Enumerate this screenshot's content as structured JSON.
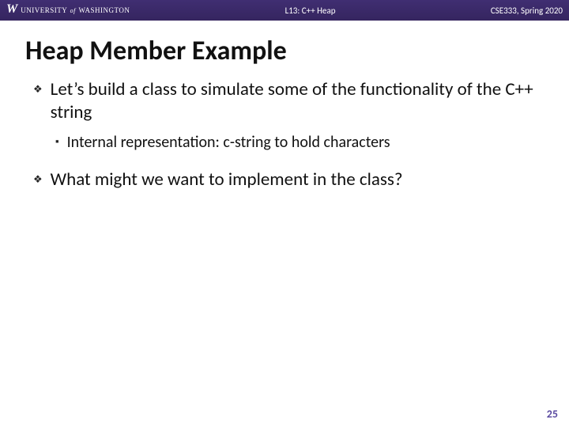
{
  "header": {
    "university_prefix": "UNIVERSITY",
    "university_of": "of",
    "university_name": "WASHINGTON",
    "center": "L13:  C++ Heap",
    "right": "CSE333, Spring 2020"
  },
  "title": "Heap Member Example",
  "bullets": [
    {
      "text": "Let’s build a class to simulate some of the functionality of the C++ string",
      "sub": [
        "Internal representation: c-string to hold characters"
      ]
    },
    {
      "text": "What might we want to implement in the class?",
      "sub": []
    }
  ],
  "page_number": "25"
}
